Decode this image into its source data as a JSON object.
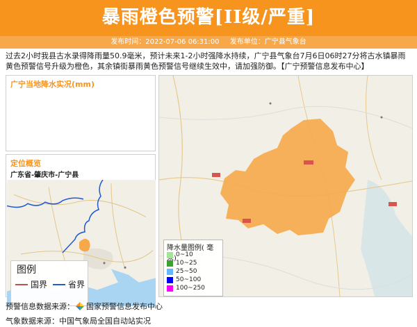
{
  "header": {
    "title": "暴雨橙色预警[II级/严重]",
    "publish_time": "发布时间：2022-07-06 06:31:00",
    "publish_unit": "发布单位：广宁县气象台",
    "accent_color": "#f7941d"
  },
  "description": "过去2小时我县古水录得降雨量50.9毫米，预计未来1-2小时强降水持续，广宁县气象台7月6日06时27分将古水镇暴雨黄色预警信号升级为橙色，其余镇街暴雨黄色预警信号继续生效中，请加强防御。【广宁预警信息发布中心】",
  "rain_panel": {
    "title": "广宁当地降水实况(mm)"
  },
  "location_panel": {
    "title": "定位概览",
    "subtitle": "广东省-肇庆市-广宁县",
    "legend_title": "图例",
    "legend_items": [
      {
        "label": "国界",
        "color": "#c0504d"
      },
      {
        "label": "省界",
        "color": "#1f5bd6"
      }
    ]
  },
  "rain_legend": {
    "title": "降水量图例( 毫米)",
    "items": [
      {
        "label": "0~10",
        "color": "#a6e29a"
      },
      {
        "label": "10~25",
        "color": "#3aa32e"
      },
      {
        "label": "25~50",
        "color": "#63b8ff"
      },
      {
        "label": "50~100",
        "color": "#0000fe"
      },
      {
        "label": "100~250",
        "color": "#fa00fa"
      }
    ]
  },
  "footer": {
    "source_warning_label": "预警信息数据来源：",
    "source_warning_value": "国家预警信息发布中心",
    "source_weather": "气象数据来源：中国气象局全国自动站实况"
  }
}
